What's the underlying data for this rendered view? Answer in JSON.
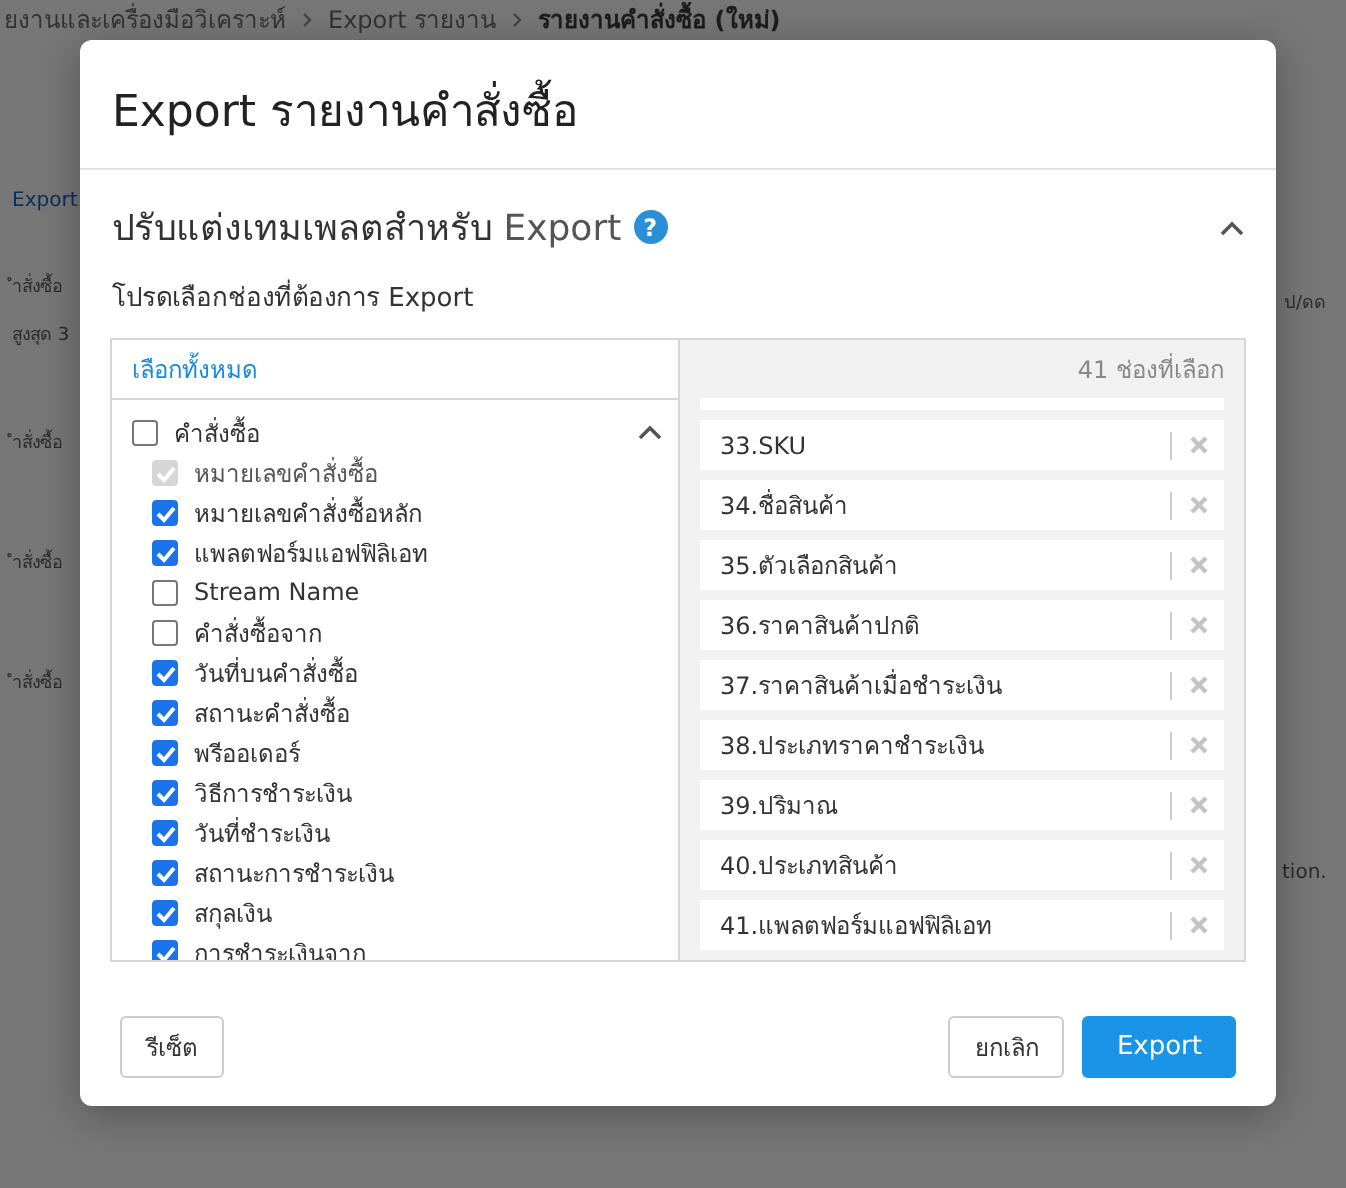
{
  "background": {
    "breadcrumb": [
      {
        "label": "ยงานและเครื่องมือวิเคราะห์",
        "current": false
      },
      {
        "label": "Export รายงาน",
        "current": false
      },
      {
        "label": "รายงานคำสั่งซื้อ (ใหม่)",
        "current": true
      }
    ],
    "left_texts": [
      {
        "text": "Export",
        "kind": "link"
      },
      {
        "text": "ำสั่งซื้อ",
        "kind": "text"
      },
      {
        "text": "สูงสุด 3",
        "kind": "text"
      },
      {
        "text": "ำสั่งซื้อ",
        "kind": "text"
      },
      {
        "text": "ำสั่งซื้อ",
        "kind": "text"
      },
      {
        "text": "ำสั่งซื้อ",
        "kind": "text"
      }
    ],
    "right_texts": [
      "ป/ดด",
      "tion."
    ]
  },
  "dialog": {
    "title": "Export รายงานคำสั่งซื้อ",
    "section": {
      "title": "ปรับแต่งเทมเพลตสำหรับ",
      "title_suffix": "Export",
      "help": "?",
      "expanded": true
    },
    "instruction": "โปรดเลือกช่องที่ต้องการ Export",
    "select_all": "เลือกทั้งหมด",
    "selected_count": "41 ช่องที่เลือก",
    "field_groups": [
      {
        "label": "คำสั่งซื้อ",
        "checked": false,
        "expanded": true,
        "children": [
          {
            "label": "หมายเลขคำสั่งซื้อ",
            "checked": true,
            "disabled": true
          },
          {
            "label": "หมายเลขคำสั่งซื้อหลัก",
            "checked": true,
            "disabled": false
          },
          {
            "label": "แพลตฟอร์มแอฟฟิลิเอท",
            "checked": true,
            "disabled": false
          },
          {
            "label": "Stream Name",
            "checked": false,
            "disabled": false
          },
          {
            "label": "คำสั่งซื้อจาก",
            "checked": false,
            "disabled": false
          },
          {
            "label": "วันที่บนคำสั่งซื้อ",
            "checked": true,
            "disabled": false
          },
          {
            "label": "สถานะคำสั่งซื้อ",
            "checked": true,
            "disabled": false
          },
          {
            "label": "พรีออเดอร์",
            "checked": true,
            "disabled": false
          },
          {
            "label": "วิธีการชำระเงิน",
            "checked": true,
            "disabled": false
          },
          {
            "label": "วันที่ชำระเงิน",
            "checked": true,
            "disabled": false
          },
          {
            "label": "สถานะการชำระเงิน",
            "checked": true,
            "disabled": false
          },
          {
            "label": "สกุลเงิน",
            "checked": true,
            "disabled": false
          },
          {
            "label": "การชำระเงินจาก",
            "checked": true,
            "disabled": false
          }
        ]
      }
    ],
    "selected_fields": [
      "33.SKU",
      "34.ชื่อสินค้า",
      "35.ตัวเลือกสินค้า",
      "36.ราคาสินค้าปกติ",
      "37.ราคาสินค้าเมื่อชำระเงิน",
      "38.ประเภทราคาชำระเงิน",
      "39.ปริมาณ",
      "40.ประเภทสินค้า",
      "41.แพลตฟอร์มแอฟฟิลิเอท"
    ],
    "buttons": {
      "reset": "รีเซ็ต",
      "cancel": "ยกเลิก",
      "export": "Export"
    }
  }
}
